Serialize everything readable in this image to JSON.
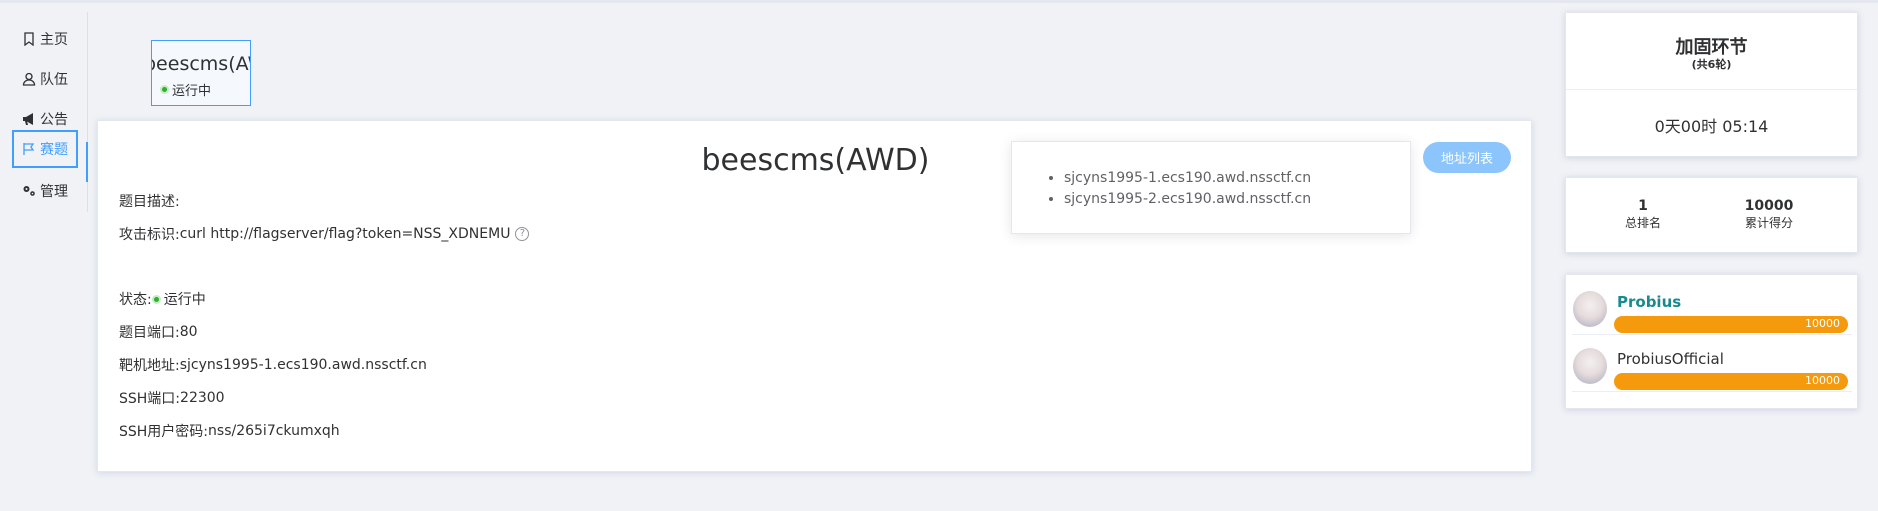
{
  "nav": [
    {
      "label": "主页",
      "icon": "bookmark-icon",
      "active": false
    },
    {
      "label": "队伍",
      "icon": "user-icon",
      "active": false
    },
    {
      "label": "公告",
      "icon": "megaphone-icon",
      "active": false
    },
    {
      "label": "赛题",
      "icon": "flag-icon",
      "active": true
    },
    {
      "label": "管理",
      "icon": "gears-icon",
      "active": false
    }
  ],
  "challenge_card": {
    "name": "beescms(AWD)",
    "status": "运行中"
  },
  "challenge": {
    "title": "beescms(AWD)",
    "description_label": "题目描述:",
    "attack_label": "攻击标识:",
    "attack_value": "curl http://flagserver/flag?token=NSS_XDNEMU",
    "help_glyph": "?",
    "status_label": "状态:",
    "status_value": "运行中",
    "port_label": "题目端口:",
    "port_value": "80",
    "target_label": "靶机地址:",
    "target_value": "sjcyns1995-1.ecs190.awd.nssctf.cn",
    "ssh_port_label": "SSH端口:",
    "ssh_port_value": "22300",
    "ssh_pass_label": "SSH用户密码:",
    "ssh_pass_value": "nss/265i7ckumxqh",
    "address_list_button": "地址列表"
  },
  "address_popover": {
    "items": [
      "sjcyns1995-1.ecs190.awd.nssctf.cn",
      "sjcyns1995-2.ecs190.awd.nssctf.cn"
    ]
  },
  "phase": {
    "title": "加固环节",
    "subtitle": "(共6轮)",
    "countdown": "0天00时 05:14"
  },
  "stats": {
    "rank_value": "1",
    "rank_label": "总排名",
    "score_value": "10000",
    "score_label": "累计得分"
  },
  "leaderboard": [
    {
      "name": "Probius",
      "score": "10000"
    },
    {
      "name": "ProbiusOfficial",
      "score": "10000"
    }
  ],
  "colors": {
    "accent": "#409eff",
    "bar": "#f59a0c",
    "team_highlight": "#1a8a8f",
    "status_dot": "#2fae2f"
  }
}
